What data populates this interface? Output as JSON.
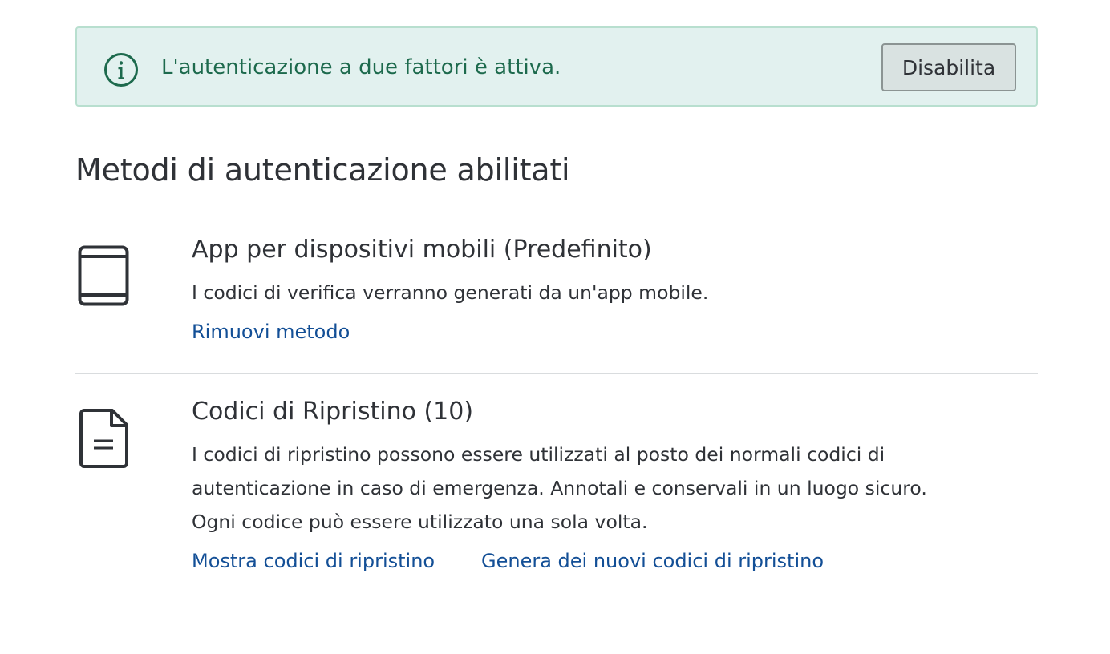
{
  "banner": {
    "message": "L'autenticazione a due fattori è attiva.",
    "disable_label": "Disabilita",
    "icon": "info-icon",
    "color": "#1d6a4d",
    "background": "#e2f1ef"
  },
  "section": {
    "title": "Metodi di autenticazione abilitati"
  },
  "methods": [
    {
      "icon": "mobile-device-icon",
      "title": "App per dispositivi mobili (Predefinito)",
      "description_lines": [
        "I codici di verifica verranno generati da un'app mobile."
      ],
      "links": [
        "Rimuovi metodo"
      ]
    },
    {
      "icon": "document-icon",
      "title": "Codici di Ripristino (10)",
      "description_lines": [
        "I codici di ripristino possono essere utilizzati al posto dei normali codici di",
        "autenticazione in caso di emergenza. Annotali e conservali in un luogo sicuro.",
        "Ogni codice può essere utilizzato una sola volta."
      ],
      "links": [
        "Mostra codici di ripristino",
        "Genera dei nuovi codici di ripristino"
      ]
    }
  ],
  "colors": {
    "link": "#134f96",
    "text": "#2f3237",
    "divider": "#d9dcde"
  }
}
